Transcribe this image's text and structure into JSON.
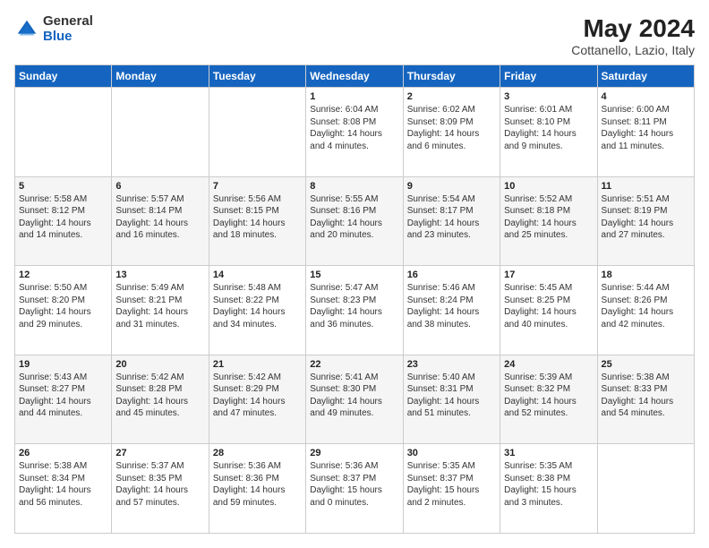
{
  "logo": {
    "general": "General",
    "blue": "Blue"
  },
  "title": "May 2024",
  "subtitle": "Cottanello, Lazio, Italy",
  "days_of_week": [
    "Sunday",
    "Monday",
    "Tuesday",
    "Wednesday",
    "Thursday",
    "Friday",
    "Saturday"
  ],
  "weeks": [
    [
      {
        "day": "",
        "info": ""
      },
      {
        "day": "",
        "info": ""
      },
      {
        "day": "",
        "info": ""
      },
      {
        "day": "1",
        "info": "Sunrise: 6:04 AM\nSunset: 8:08 PM\nDaylight: 14 hours\nand 4 minutes."
      },
      {
        "day": "2",
        "info": "Sunrise: 6:02 AM\nSunset: 8:09 PM\nDaylight: 14 hours\nand 6 minutes."
      },
      {
        "day": "3",
        "info": "Sunrise: 6:01 AM\nSunset: 8:10 PM\nDaylight: 14 hours\nand 9 minutes."
      },
      {
        "day": "4",
        "info": "Sunrise: 6:00 AM\nSunset: 8:11 PM\nDaylight: 14 hours\nand 11 minutes."
      }
    ],
    [
      {
        "day": "5",
        "info": "Sunrise: 5:58 AM\nSunset: 8:12 PM\nDaylight: 14 hours\nand 14 minutes."
      },
      {
        "day": "6",
        "info": "Sunrise: 5:57 AM\nSunset: 8:14 PM\nDaylight: 14 hours\nand 16 minutes."
      },
      {
        "day": "7",
        "info": "Sunrise: 5:56 AM\nSunset: 8:15 PM\nDaylight: 14 hours\nand 18 minutes."
      },
      {
        "day": "8",
        "info": "Sunrise: 5:55 AM\nSunset: 8:16 PM\nDaylight: 14 hours\nand 20 minutes."
      },
      {
        "day": "9",
        "info": "Sunrise: 5:54 AM\nSunset: 8:17 PM\nDaylight: 14 hours\nand 23 minutes."
      },
      {
        "day": "10",
        "info": "Sunrise: 5:52 AM\nSunset: 8:18 PM\nDaylight: 14 hours\nand 25 minutes."
      },
      {
        "day": "11",
        "info": "Sunrise: 5:51 AM\nSunset: 8:19 PM\nDaylight: 14 hours\nand 27 minutes."
      }
    ],
    [
      {
        "day": "12",
        "info": "Sunrise: 5:50 AM\nSunset: 8:20 PM\nDaylight: 14 hours\nand 29 minutes."
      },
      {
        "day": "13",
        "info": "Sunrise: 5:49 AM\nSunset: 8:21 PM\nDaylight: 14 hours\nand 31 minutes."
      },
      {
        "day": "14",
        "info": "Sunrise: 5:48 AM\nSunset: 8:22 PM\nDaylight: 14 hours\nand 34 minutes."
      },
      {
        "day": "15",
        "info": "Sunrise: 5:47 AM\nSunset: 8:23 PM\nDaylight: 14 hours\nand 36 minutes."
      },
      {
        "day": "16",
        "info": "Sunrise: 5:46 AM\nSunset: 8:24 PM\nDaylight: 14 hours\nand 38 minutes."
      },
      {
        "day": "17",
        "info": "Sunrise: 5:45 AM\nSunset: 8:25 PM\nDaylight: 14 hours\nand 40 minutes."
      },
      {
        "day": "18",
        "info": "Sunrise: 5:44 AM\nSunset: 8:26 PM\nDaylight: 14 hours\nand 42 minutes."
      }
    ],
    [
      {
        "day": "19",
        "info": "Sunrise: 5:43 AM\nSunset: 8:27 PM\nDaylight: 14 hours\nand 44 minutes."
      },
      {
        "day": "20",
        "info": "Sunrise: 5:42 AM\nSunset: 8:28 PM\nDaylight: 14 hours\nand 45 minutes."
      },
      {
        "day": "21",
        "info": "Sunrise: 5:42 AM\nSunset: 8:29 PM\nDaylight: 14 hours\nand 47 minutes."
      },
      {
        "day": "22",
        "info": "Sunrise: 5:41 AM\nSunset: 8:30 PM\nDaylight: 14 hours\nand 49 minutes."
      },
      {
        "day": "23",
        "info": "Sunrise: 5:40 AM\nSunset: 8:31 PM\nDaylight: 14 hours\nand 51 minutes."
      },
      {
        "day": "24",
        "info": "Sunrise: 5:39 AM\nSunset: 8:32 PM\nDaylight: 14 hours\nand 52 minutes."
      },
      {
        "day": "25",
        "info": "Sunrise: 5:38 AM\nSunset: 8:33 PM\nDaylight: 14 hours\nand 54 minutes."
      }
    ],
    [
      {
        "day": "26",
        "info": "Sunrise: 5:38 AM\nSunset: 8:34 PM\nDaylight: 14 hours\nand 56 minutes."
      },
      {
        "day": "27",
        "info": "Sunrise: 5:37 AM\nSunset: 8:35 PM\nDaylight: 14 hours\nand 57 minutes."
      },
      {
        "day": "28",
        "info": "Sunrise: 5:36 AM\nSunset: 8:36 PM\nDaylight: 14 hours\nand 59 minutes."
      },
      {
        "day": "29",
        "info": "Sunrise: 5:36 AM\nSunset: 8:37 PM\nDaylight: 15 hours\nand 0 minutes."
      },
      {
        "day": "30",
        "info": "Sunrise: 5:35 AM\nSunset: 8:37 PM\nDaylight: 15 hours\nand 2 minutes."
      },
      {
        "day": "31",
        "info": "Sunrise: 5:35 AM\nSunset: 8:38 PM\nDaylight: 15 hours\nand 3 minutes."
      },
      {
        "day": "",
        "info": ""
      }
    ]
  ]
}
